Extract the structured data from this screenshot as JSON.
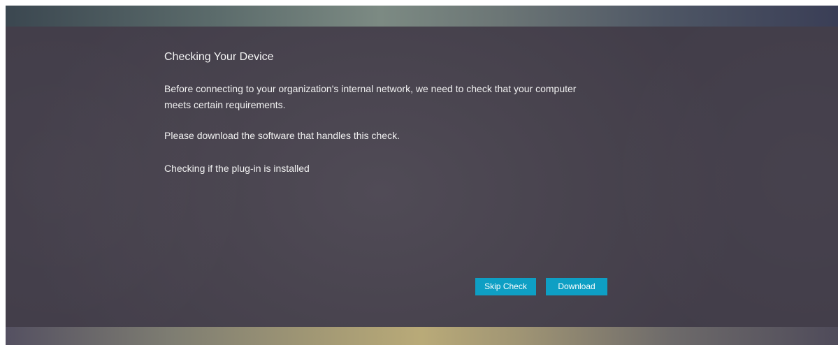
{
  "dialog": {
    "title": "Checking Your Device",
    "paragraph_1": "Before connecting to your organization's internal network, we need to check that your computer meets certain requirements.",
    "paragraph_2": "Please download the software that handles this check.",
    "status_text": "Checking if the plug-in is installed"
  },
  "actions": {
    "skip_label": "Skip Check",
    "download_label": "Download"
  },
  "colors": {
    "button_background": "#0e9fc4",
    "panel_background": "#48434e",
    "text": "#ffffff"
  }
}
